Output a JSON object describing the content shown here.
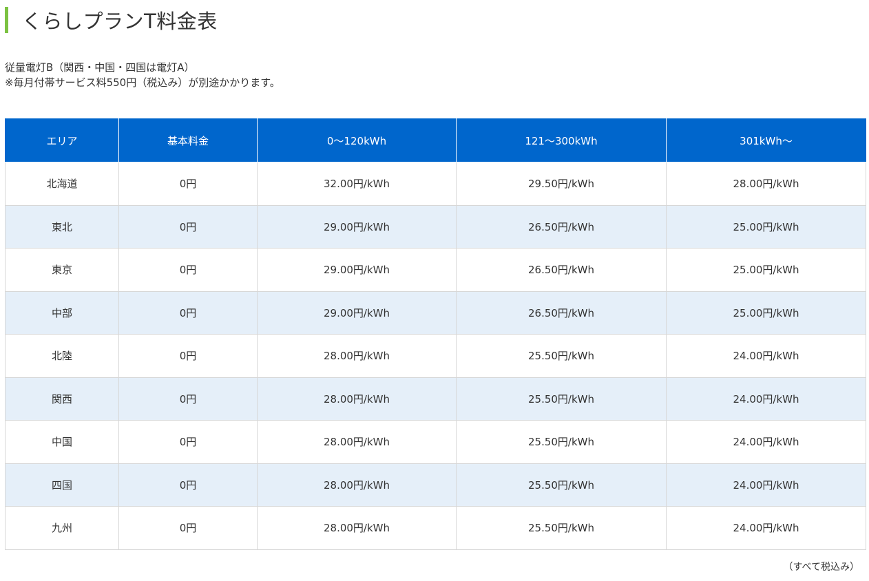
{
  "page": {
    "title": "くらしプランT料金表",
    "notes": [
      "従量電灯B（関西・中国・四国は電灯A）",
      "※毎月付帯サービス料550円（税込み）が別途かかります。"
    ],
    "footnote": "（すべて税込み）"
  },
  "table": {
    "headers": [
      "エリア",
      "基本料金",
      "0～120kWh",
      "121～300kWh",
      "301kWh～"
    ],
    "rows": [
      [
        "北海道",
        "0円",
        "32.00円/kWh",
        "29.50円/kWh",
        "28.00円/kWh"
      ],
      [
        "東北",
        "0円",
        "29.00円/kWh",
        "26.50円/kWh",
        "25.00円/kWh"
      ],
      [
        "東京",
        "0円",
        "29.00円/kWh",
        "26.50円/kWh",
        "25.00円/kWh"
      ],
      [
        "中部",
        "0円",
        "29.00円/kWh",
        "26.50円/kWh",
        "25.00円/kWh"
      ],
      [
        "北陸",
        "0円",
        "28.00円/kWh",
        "25.50円/kWh",
        "24.00円/kWh"
      ],
      [
        "関西",
        "0円",
        "28.00円/kWh",
        "25.50円/kWh",
        "24.00円/kWh"
      ],
      [
        "中国",
        "0円",
        "28.00円/kWh",
        "25.50円/kWh",
        "24.00円/kWh"
      ],
      [
        "四国",
        "0円",
        "28.00円/kWh",
        "25.50円/kWh",
        "24.00円/kWh"
      ],
      [
        "九州",
        "0円",
        "28.00円/kWh",
        "25.50円/kWh",
        "24.00円/kWh"
      ]
    ]
  },
  "colors": {
    "accent_bar": "#7cc242",
    "header_bg": "#0066cc",
    "stripe_bg": "#e5eff9"
  }
}
